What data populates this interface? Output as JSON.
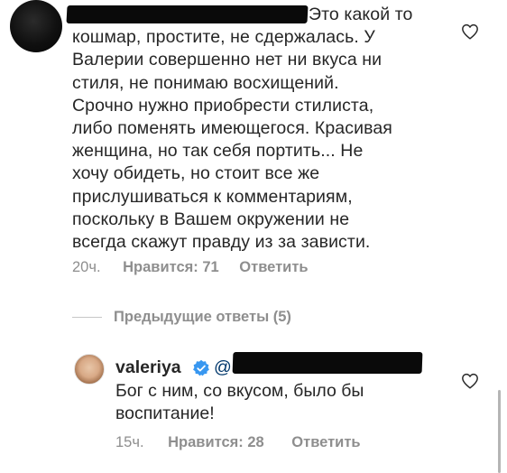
{
  "comment": {
    "text_line1": "Это какой то",
    "text_rest": "кошмар, простите, не сдержалась. У\nВалерии совершенно нет ни  вкуса ни\nстиля, не понимаю восхищений.\nСрочно нужно приобрести стилиста,\nлибо поменять имеющегося. Красивая\nженщина, но так себя портить... Не\nхочу обидеть, но стоит все же\nприслушиваться к комментариям,\nпоскольку в Вашем окружении не\nвсегда скажут правду из за зависти.",
    "time": "20ч.",
    "likes": "Нравится: 71",
    "reply_button": "Ответить"
  },
  "previous_replies_label": "Предыдущие ответы (5)",
  "reply": {
    "username": "valeriya",
    "mention_prefix": "@",
    "text": "Бог с ним, со вкусом, было бы\nвоспитание!",
    "time": "15ч.",
    "likes": "Нравится: 28",
    "reply_button": "Ответить"
  },
  "colors": {
    "text": "#262626",
    "secondary": "#8e8e8e",
    "verified": "#3897f0",
    "mention": "#00376b",
    "redaction": "#0a0a0a"
  },
  "icons": {
    "like": "heart-outline-icon",
    "verified": "verified-badge-icon"
  }
}
